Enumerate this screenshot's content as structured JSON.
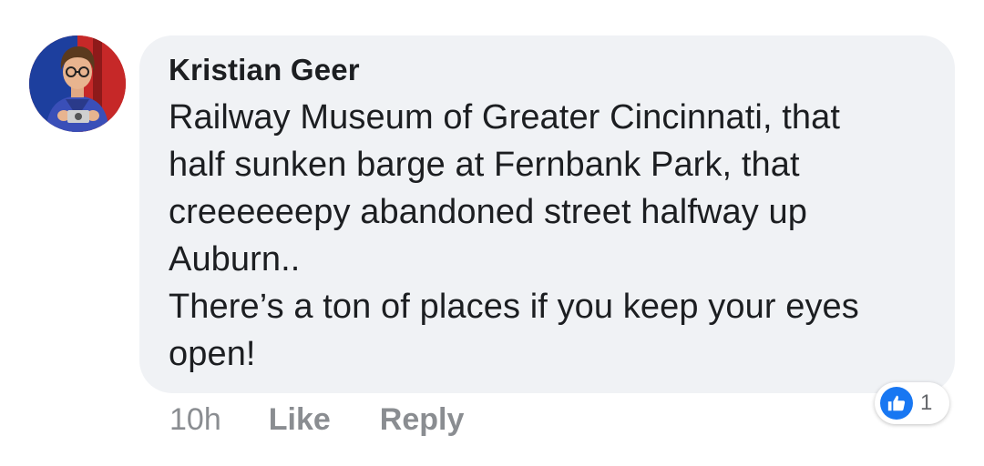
{
  "comment": {
    "author": "Kristian Geer",
    "lines": [
      "Railway Museum of Greater Cincinnati, that",
      "half sunken barge at Fernbank Park, that",
      "creeeeeepy abandoned street halfway up",
      "Auburn..",
      "There’s a ton of places if you keep your eyes",
      "open!"
    ],
    "reactions": {
      "icon": "thumbs-up-icon",
      "count": "1"
    }
  },
  "actions": {
    "time": "10h",
    "like_label": "Like",
    "reply_label": "Reply"
  },
  "colors": {
    "bubble": "#f0f2f5",
    "text": "#1c1e21",
    "muted": "#8a8d91",
    "accent": "#1877f2"
  }
}
